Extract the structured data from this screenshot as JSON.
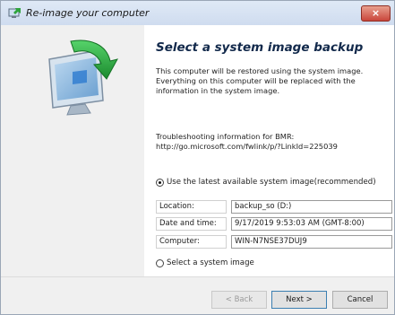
{
  "window": {
    "title": "Re-image your computer",
    "close_label": "×"
  },
  "main": {
    "heading": "Select a system image backup",
    "description": "This computer will be restored using the system image. Everything on this computer will be replaced with the information in the system image.",
    "troubleshoot_line1": "Troubleshooting information for BMR:",
    "troubleshoot_line2": "http://go.microsoft.com/fwlink/p/?LinkId=225039",
    "option_latest": "Use the latest available system image(recommended)",
    "option_select": "Select a system image",
    "selected_option": "latest"
  },
  "details": {
    "location_label": "Location:",
    "location_value": "backup_so (D:)",
    "date_label": "Date and time:",
    "date_value": "9/17/2019 9:53:03 AM (GMT-8:00)",
    "computer_label": "Computer:",
    "computer_value": "WIN-N7NSE37DUJ9"
  },
  "buttons": {
    "back": "< Back",
    "next": "Next >",
    "cancel": "Cancel"
  }
}
